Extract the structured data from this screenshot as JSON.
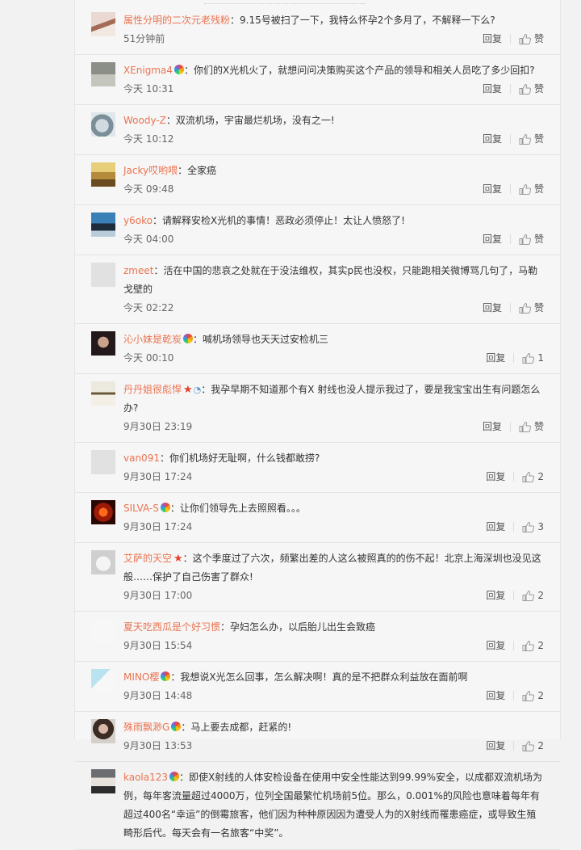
{
  "labels": {
    "reply": "回复",
    "like": "赞"
  },
  "comments": [
    {
      "user": "属性分明的二次元老残粉",
      "badges": [],
      "content": "：9.15号被扫了一下，我特么怀孕2个多月了，不解释一下么?",
      "time": "51分钟前",
      "likes": ""
    },
    {
      "user": "XEnigma4",
      "badges": [
        "rainbow"
      ],
      "content": "：你们的X光机火了，就想问问决策购买这个产品的领导和相关人员吃了多少回扣?",
      "time": "今天 10:31",
      "likes": ""
    },
    {
      "user": "Woody-Z",
      "badges": [],
      "content": "：双流机场，宇宙最烂机场，没有之一!",
      "time": "今天 10:12",
      "likes": ""
    },
    {
      "user": "Jacky哎哟喂",
      "badges": [],
      "content": "：全家癌",
      "time": "今天 09:48",
      "likes": ""
    },
    {
      "user": "y6oko",
      "badges": [],
      "content": "：请解释安检X光机的事情！恶政必须停止！太让人愤怒了!",
      "time": "今天 04:00",
      "likes": ""
    },
    {
      "user": "zmeet",
      "badges": [],
      "content": "：活在中国的悲哀之处就在于没法维权，其实p民也没权，只能跑相关微博骂几句了，马勒戈壁的",
      "time": "今天 02:22",
      "likes": ""
    },
    {
      "user": "沁小妹是乾炭",
      "badges": [
        "rainbow"
      ],
      "content": "：喊机场领导也天天过安检机三",
      "time": "今天 00:10",
      "likes": "1"
    },
    {
      "user": "丹丹姐很彪悍",
      "badges": [
        "star",
        "ring"
      ],
      "content": "：我孕早期不知道那个有X 射线也没人提示我过了，要是我宝宝出生有问题怎么办?",
      "time": "9月30日 23:19",
      "likes": ""
    },
    {
      "user": "van091",
      "badges": [],
      "content": "：你们机场好无耻啊，什么钱都敢捞?",
      "time": "9月30日 17:24",
      "likes": "2"
    },
    {
      "user": "SILVA-S",
      "badges": [
        "rainbow"
      ],
      "content": "：让你们领导先上去照照看。。。",
      "time": "9月30日 17:24",
      "likes": "3"
    },
    {
      "user": "艾萨的天空",
      "badges": [
        "star"
      ],
      "content": "：这个季度过了六次，频繁出差的人这么被照真的的伤不起！北京上海深圳也没见这般……保护了自己伤害了群众!",
      "time": "9月30日 17:00",
      "likes": "2"
    },
    {
      "user": "夏天吃西瓜是个好习惯",
      "badges": [],
      "content": "：孕妇怎么办，以后胎儿出生会致癌",
      "time": "9月30日 15:54",
      "likes": "2"
    },
    {
      "user": "MINO樱",
      "badges": [
        "rainbow"
      ],
      "content": "：我想说X光怎么回事，怎么解决啊！真的是不把群众利益放在面前啊",
      "time": "9月30日 14:48",
      "likes": "2"
    },
    {
      "user": "殊雨飘渺G",
      "badges": [
        "rainbow"
      ],
      "content": "：马上要去成都，赶紧的!",
      "time": "9月30日 13:53",
      "likes": "2"
    },
    {
      "user": "kaola123",
      "badges": [
        "rainbow"
      ],
      "content": "：即使X射线的人体安检设备在使用中安全性能达到99.99%安全，以成都双流机场为例，每年客流量超过4000万，位列全国最繁忙机场前5位。那么，0.001%的风险也意味着每年有超过400名“幸运”的倒霉旅客，他们因为种种原因因为遭受人为的X射线而罹患癌症，或导致生殖畸形后代。每天会有一名旅客“中奖”。",
      "time": "",
      "likes": ""
    }
  ]
}
